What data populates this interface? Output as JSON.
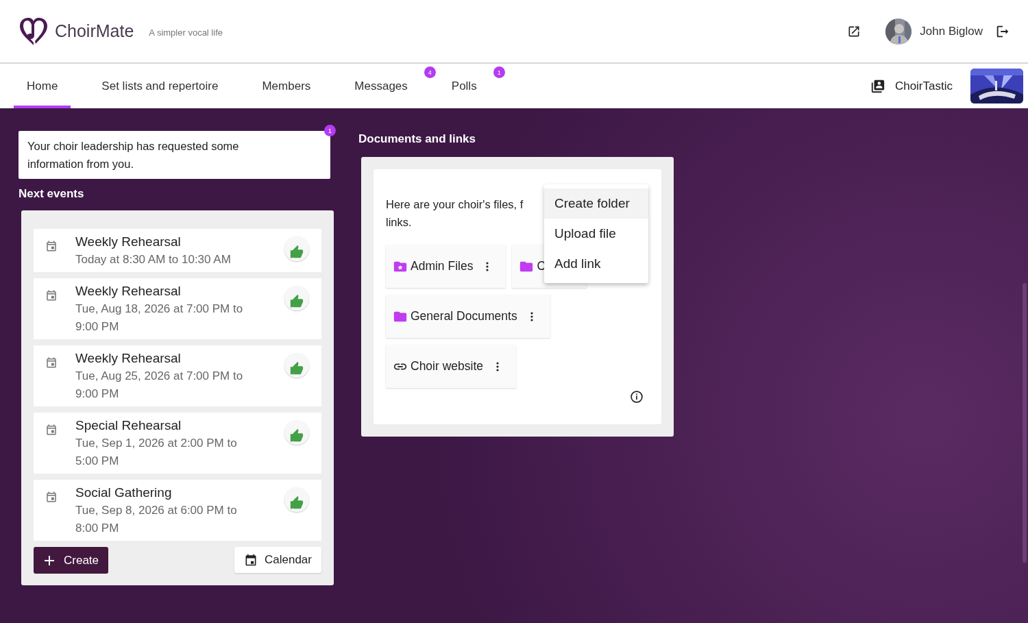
{
  "header": {
    "app_name": "ChoirMate",
    "tagline": "A simpler vocal life",
    "user_name": "John Biglow"
  },
  "tabs": [
    {
      "label": "Home",
      "selected": true
    },
    {
      "label": "Set lists and repertoire",
      "selected": false
    },
    {
      "label": "Members",
      "selected": false
    },
    {
      "label": "Messages",
      "selected": false,
      "badge": "4"
    },
    {
      "label": "Polls",
      "selected": false,
      "badge": "1"
    }
  ],
  "choir": {
    "name": "ChoirTastic"
  },
  "notice": {
    "text": "Your choir leadership has requested some information from you.",
    "badge": "1"
  },
  "next_events": {
    "title": "Next events",
    "events": [
      {
        "title": "Weekly Rehearsal",
        "when": "Today at 8:30 AM to 10:30 AM"
      },
      {
        "title": "Weekly Rehearsal",
        "when": "Tue, Aug 18, 2026 at 7:00 PM to 9:00 PM"
      },
      {
        "title": "Weekly Rehearsal",
        "when": "Tue, Aug 25, 2026 at 7:00 PM to 9:00 PM"
      },
      {
        "title": "Special Rehearsal",
        "when": "Tue, Sep 1, 2026 at 2:00 PM to 5:00 PM"
      },
      {
        "title": "Social Gathering",
        "when": "Tue, Sep 8, 2026 at 6:00 PM to 8:00 PM"
      }
    ],
    "create_button": "Create",
    "calendar_button": "Calendar"
  },
  "documents": {
    "title": "Documents and links",
    "description": [
      "Here are your choir's files, f",
      "links."
    ],
    "items": [
      {
        "kind": "starred-folder",
        "label": "Admin Files"
      },
      {
        "kind": "folder",
        "label": "C"
      },
      {
        "kind": "folder",
        "label": "General Documents"
      },
      {
        "kind": "link",
        "label": "Choir website"
      }
    ],
    "menu": [
      {
        "label": "Create folder",
        "highlighted": true
      },
      {
        "label": "Upload file",
        "highlighted": false
      },
      {
        "label": "Add link",
        "highlighted": false
      }
    ]
  }
}
